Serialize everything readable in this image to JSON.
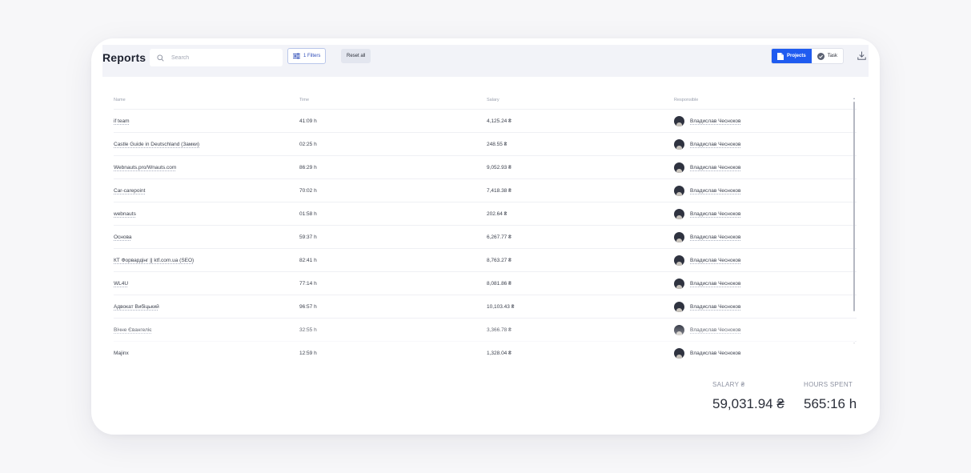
{
  "header": {
    "title": "Reports",
    "search_placeholder": "Search",
    "filters_label": "1 Filters",
    "reset_label": "Reset all",
    "view_toggle": [
      {
        "label": "Projects",
        "active": true,
        "icon": "projects-icon"
      },
      {
        "label": "Task",
        "active": false,
        "icon": "check-circle-icon"
      }
    ],
    "download_icon": "download-icon"
  },
  "table": {
    "columns": [
      "Name",
      "Time",
      "Salary",
      "Responsible"
    ],
    "rows": [
      {
        "name": "if team",
        "time": "41:09 h",
        "salary": "4,125.24 ₴",
        "responsible": "Владислав Чесноков"
      },
      {
        "name": "Castle Guide in Deutschland (Замки)",
        "time": "02:25 h",
        "salary": "248.55 ₴",
        "responsible": "Владислав Чесноков"
      },
      {
        "name": "Webnauts.pro/Wnauts.com",
        "time": "86:29 h",
        "salary": "9,052.93 ₴",
        "responsible": "Владислав Чесноков"
      },
      {
        "name": "Car-carepoint",
        "time": "70:02 h",
        "salary": "7,418.38 ₴",
        "responsible": "Владислав Чесноков"
      },
      {
        "name": "webnauts",
        "time": "01:58 h",
        "salary": "202.64 ₴",
        "responsible": "Владислав Чесноков"
      },
      {
        "name": "Основа",
        "time": "59:37 h",
        "salary": "6,267.77 ₴",
        "responsible": "Владислав Чесноков"
      },
      {
        "name": "КТ Форвардінг || ktf.com.ua (SEO)",
        "time": "82:41 h",
        "salary": "8,763.27 ₴",
        "responsible": "Владислав Чесноков"
      },
      {
        "name": "WL4U",
        "time": "77:14 h",
        "salary": "8,081.86 ₴",
        "responsible": "Владислав Чесноков"
      },
      {
        "name": "Адвокат Вибіцький",
        "time": "96:57 h",
        "salary": "10,103.43 ₴",
        "responsible": "Владислав Чесноков"
      },
      {
        "name": "Вічне Євангеліє",
        "time": "32:55 h",
        "salary": "3,366.78 ₴",
        "responsible": "Владислав Чесноков"
      },
      {
        "name": "Majinx",
        "time": "12:59 h",
        "salary": "1,328.04 ₴",
        "responsible": "Владислав Чесноков"
      }
    ]
  },
  "totals": {
    "salary_label": "SALARY ₴",
    "salary_value": "59,031.94 ₴",
    "hours_label": "HOURS SPENT",
    "hours_value": "565:16 h"
  },
  "colors": {
    "accent": "#1f5bf0",
    "topbar_bg": "#f2f3f8",
    "page_bg": "#f7f7f9"
  }
}
